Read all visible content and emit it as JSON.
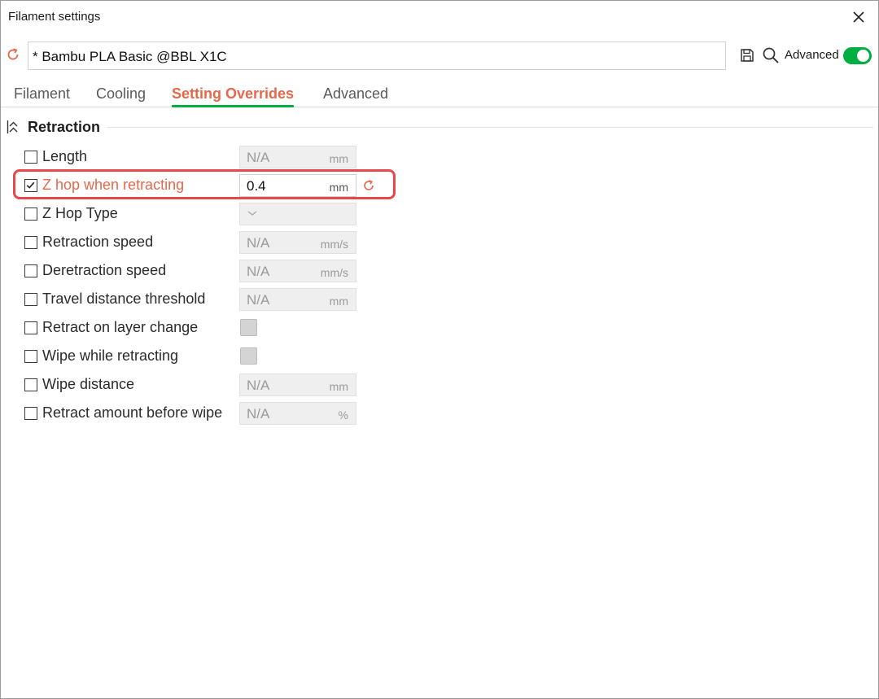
{
  "window": {
    "title": "Filament settings"
  },
  "preset": {
    "name": "* Bambu PLA Basic @BBL X1C"
  },
  "header": {
    "advanced_label": "Advanced",
    "advanced_on": true
  },
  "colors": {
    "accent": "#e8674a",
    "green": "#00ae42",
    "highlight": "#e8474c"
  },
  "tabs": [
    {
      "label": "Filament",
      "active": false
    },
    {
      "label": "Cooling",
      "active": false
    },
    {
      "label": "Setting Overrides",
      "active": true
    },
    {
      "label": "Advanced",
      "active": false
    }
  ],
  "section": {
    "title": "Retraction"
  },
  "rows": [
    {
      "label": "Length",
      "checked": false,
      "kind": "number",
      "value": "N/A",
      "unit": "mm"
    },
    {
      "label": "Z hop when retracting",
      "checked": true,
      "kind": "number",
      "value": "0.4",
      "unit": "mm",
      "changed": true,
      "highlighted": true
    },
    {
      "label": "Z Hop Type",
      "checked": false,
      "kind": "select",
      "value": "",
      "unit": ""
    },
    {
      "label": "Retraction speed",
      "checked": false,
      "kind": "number",
      "value": "N/A",
      "unit": "mm/s"
    },
    {
      "label": "Deretraction speed",
      "checked": false,
      "kind": "number",
      "value": "N/A",
      "unit": "mm/s"
    },
    {
      "label": "Travel distance threshold",
      "checked": false,
      "kind": "number",
      "value": "N/A",
      "unit": "mm"
    },
    {
      "label": "Retract on layer change",
      "checked": false,
      "kind": "bool"
    },
    {
      "label": "Wipe while retracting",
      "checked": false,
      "kind": "bool"
    },
    {
      "label": "Wipe distance",
      "checked": false,
      "kind": "number",
      "value": "N/A",
      "unit": "mm"
    },
    {
      "label": "Retract amount before wipe",
      "checked": false,
      "kind": "number",
      "value": "N/A",
      "unit": "%"
    }
  ]
}
